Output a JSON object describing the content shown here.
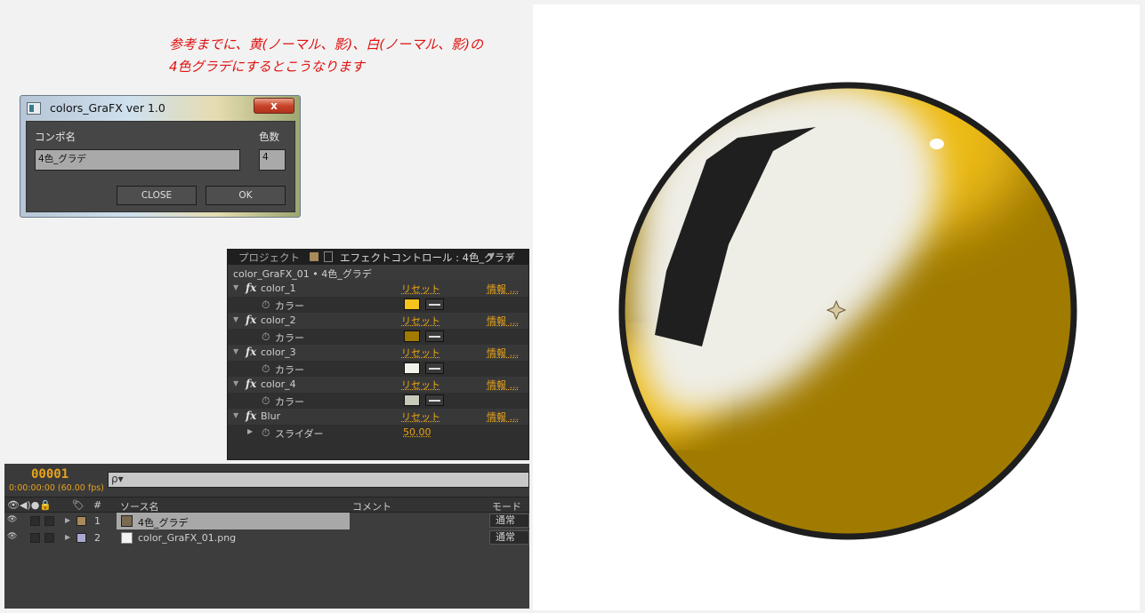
{
  "note": {
    "line1": "参考までに、黄(ノーマル、影)、白(ノーマル、影)の",
    "line2": "4色グラデにするとこうなります"
  },
  "dialog": {
    "title": "colors_GraFX ver 1.0",
    "close_x": "x",
    "comp_name_label": "コンポ名",
    "comp_name_value": "4色_グラデ",
    "color_count_label": "色数",
    "color_count_value": "4",
    "close_button": "CLOSE",
    "ok_button": "OK"
  },
  "effects_panel": {
    "tab_project": "プロジェクト",
    "tab_effects": "エフェクトコントロール : 4色_グラデ",
    "breadcrumb": "color_GraFX_01 • 4色_グラデ",
    "reset_label": "リセット",
    "info_label": "情報 ...",
    "color_prop_label": "カラー",
    "effects": [
      {
        "name": "color_1",
        "color": "#f6c31b"
      },
      {
        "name": "color_2",
        "color": "#a17b00"
      },
      {
        "name": "color_3",
        "color": "#f2f2ea"
      },
      {
        "name": "color_4",
        "color": "#c9c9bc"
      }
    ],
    "blur": {
      "name": "Blur",
      "slider_label": "スライダー",
      "value": "50.00"
    }
  },
  "timeline": {
    "timecode": "00001",
    "fps": "0:00:00:00 (60.00 fps)",
    "search_icon": "ρ▾",
    "col_hash": "#",
    "col_source": "ソース名",
    "col_comment": "コメント",
    "col_mode": "モード",
    "layers": [
      {
        "num": "1",
        "name": "4色_グラデ",
        "mode": "通常",
        "label_color": "#a98a5a",
        "selected": true
      },
      {
        "num": "2",
        "name": "color_GraFX_01.png",
        "mode": "通常",
        "label_color": "#a9a9d0",
        "selected": false
      }
    ]
  },
  "colors": {
    "yellow": "#f6c31b",
    "shadow_yellow": "#a17b00",
    "white": "#efeee6",
    "outline": "#1e1e1e",
    "accent": "#e8a31c"
  }
}
